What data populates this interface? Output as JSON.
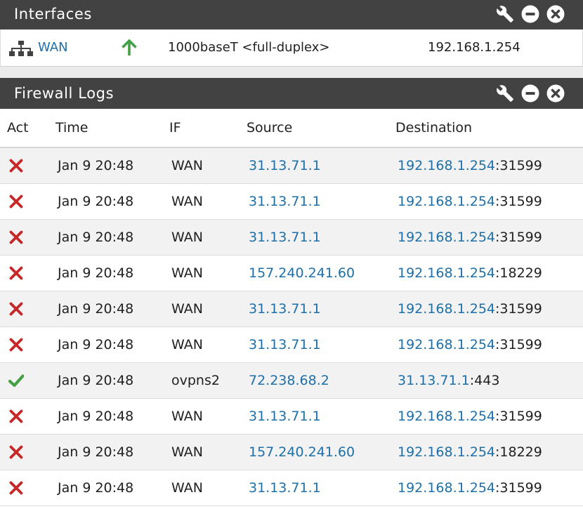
{
  "interfaces": {
    "title": "Interfaces",
    "rows": [
      {
        "name": "WAN",
        "status": "up",
        "media": "1000baseT <full-duplex>",
        "ip": "192.168.1.254"
      }
    ]
  },
  "firewall_logs": {
    "title": "Firewall Logs",
    "columns": [
      "Act",
      "Time",
      "IF",
      "Source",
      "Destination"
    ],
    "rows": [
      {
        "act": "block",
        "time": "Jan 9 20:48",
        "iface": "WAN",
        "source": "31.13.71.1",
        "dest_ip": "192.168.1.254",
        "dest_port": ":31599"
      },
      {
        "act": "block",
        "time": "Jan 9 20:48",
        "iface": "WAN",
        "source": "31.13.71.1",
        "dest_ip": "192.168.1.254",
        "dest_port": ":31599"
      },
      {
        "act": "block",
        "time": "Jan 9 20:48",
        "iface": "WAN",
        "source": "31.13.71.1",
        "dest_ip": "192.168.1.254",
        "dest_port": ":31599"
      },
      {
        "act": "block",
        "time": "Jan 9 20:48",
        "iface": "WAN",
        "source": "157.240.241.60",
        "dest_ip": "192.168.1.254",
        "dest_port": ":18229"
      },
      {
        "act": "block",
        "time": "Jan 9 20:48",
        "iface": "WAN",
        "source": "31.13.71.1",
        "dest_ip": "192.168.1.254",
        "dest_port": ":31599"
      },
      {
        "act": "block",
        "time": "Jan 9 20:48",
        "iface": "WAN",
        "source": "31.13.71.1",
        "dest_ip": "192.168.1.254",
        "dest_port": ":31599"
      },
      {
        "act": "pass",
        "time": "Jan 9 20:48",
        "iface": "ovpns2",
        "source": "72.238.68.2",
        "dest_ip": "31.13.71.1",
        "dest_port": ":443"
      },
      {
        "act": "block",
        "time": "Jan 9 20:48",
        "iface": "WAN",
        "source": "31.13.71.1",
        "dest_ip": "192.168.1.254",
        "dest_port": ":31599"
      },
      {
        "act": "block",
        "time": "Jan 9 20:48",
        "iface": "WAN",
        "source": "157.240.241.60",
        "dest_ip": "192.168.1.254",
        "dest_port": ":18229"
      },
      {
        "act": "block",
        "time": "Jan 9 20:48",
        "iface": "WAN",
        "source": "31.13.71.1",
        "dest_ip": "192.168.1.254",
        "dest_port": ":31599"
      }
    ]
  },
  "icons": {
    "settings": "wrench-icon",
    "minimize": "minus-circle-icon",
    "close": "close-circle-icon",
    "interface": "network-icon",
    "status_up": "arrow-up-icon",
    "block": "block-x-icon",
    "pass": "pass-check-icon"
  },
  "colors": {
    "header_bg": "#424242",
    "link": "#1e6fa8",
    "block": "#c62828",
    "pass": "#43a047",
    "row_alt": "#f2f2f2"
  }
}
